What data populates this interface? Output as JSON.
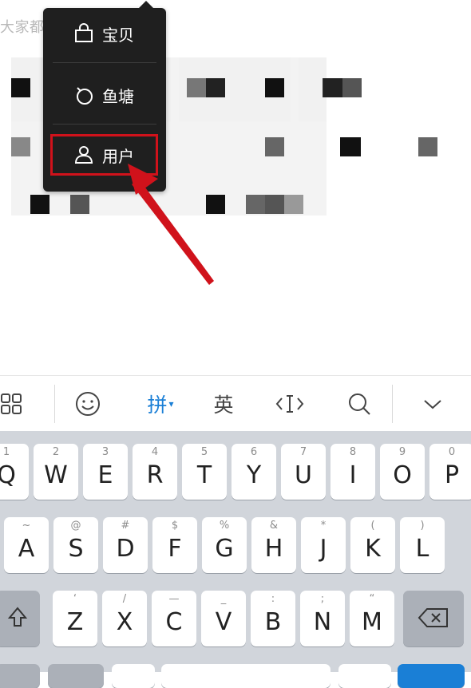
{
  "search": {
    "placeholder_text": "大家都在搜"
  },
  "menu": {
    "items": [
      {
        "label": "宝贝",
        "icon": "bag-icon"
      },
      {
        "label": "鱼塘",
        "icon": "pond-ring-icon"
      },
      {
        "label": "用户",
        "icon": "user-icon"
      }
    ]
  },
  "toolbar": {
    "grid_icon": "grid-icon",
    "emoji_icon": "emoji-icon",
    "pinyin_label": "拼",
    "english_label": "英",
    "cursor_icon": "cursor-move-icon",
    "search_icon": "search-icon",
    "collapse_icon": "chevron-down-icon"
  },
  "keyboard": {
    "row1": [
      {
        "hint": "1",
        "key": "Q"
      },
      {
        "hint": "2",
        "key": "W"
      },
      {
        "hint": "3",
        "key": "E"
      },
      {
        "hint": "4",
        "key": "R"
      },
      {
        "hint": "5",
        "key": "T"
      },
      {
        "hint": "6",
        "key": "Y"
      },
      {
        "hint": "7",
        "key": "U"
      },
      {
        "hint": "8",
        "key": "I"
      },
      {
        "hint": "9",
        "key": "O"
      },
      {
        "hint": "0",
        "key": "P"
      }
    ],
    "row2": [
      {
        "hint": "~",
        "key": "A"
      },
      {
        "hint": "@",
        "key": "S"
      },
      {
        "hint": "#",
        "key": "D"
      },
      {
        "hint": "$",
        "key": "F"
      },
      {
        "hint": "%",
        "key": "G"
      },
      {
        "hint": "&",
        "key": "H"
      },
      {
        "hint": "*",
        "key": "J"
      },
      {
        "hint": "(",
        "key": "K"
      },
      {
        "hint": ")",
        "key": "L"
      }
    ],
    "row3": [
      {
        "hint": "‘",
        "key": "Z"
      },
      {
        "hint": "/",
        "key": "X"
      },
      {
        "hint": "—",
        "key": "C"
      },
      {
        "hint": "_",
        "key": "V"
      },
      {
        "hint": ":",
        "key": "B"
      },
      {
        "hint": ";",
        "key": "N"
      },
      {
        "hint": "“",
        "key": "M"
      }
    ]
  },
  "colors": {
    "highlight": "#d0121b",
    "accent_blue": "#1a7fd6",
    "menu_bg": "#1f1f1f"
  }
}
